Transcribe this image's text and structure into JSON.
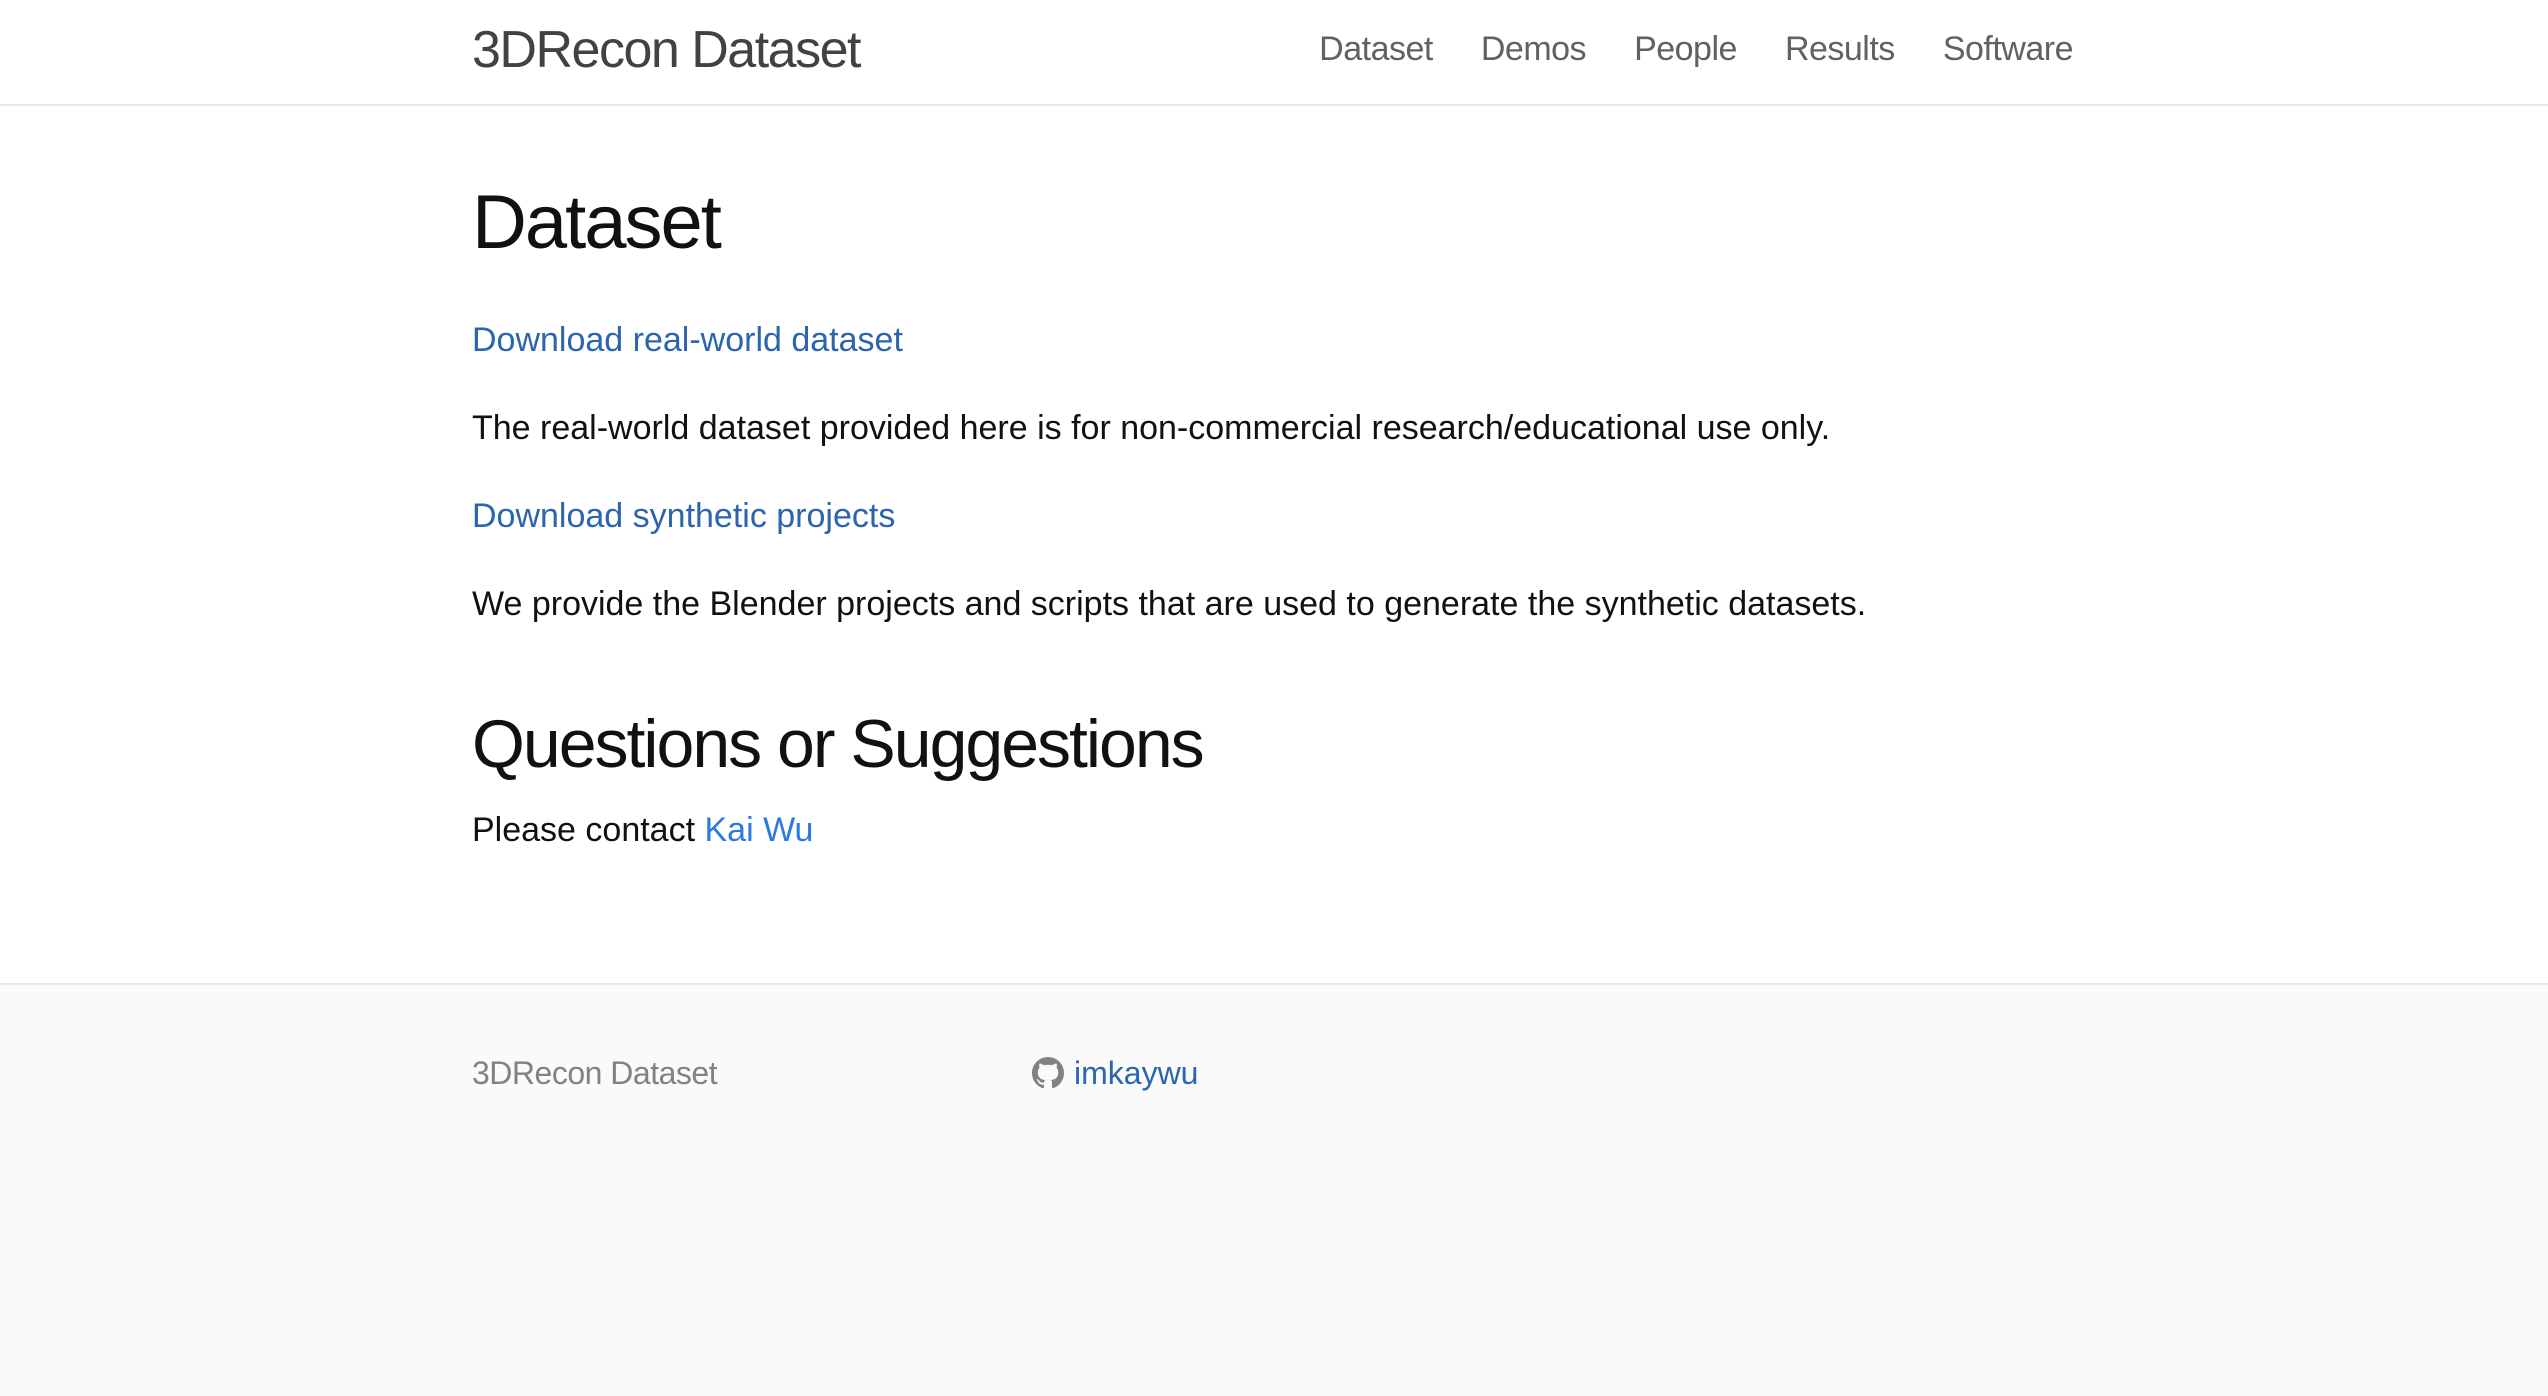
{
  "header": {
    "site_title": "3DRecon Dataset",
    "nav": [
      {
        "label": "Dataset"
      },
      {
        "label": "Demos"
      },
      {
        "label": "People"
      },
      {
        "label": "Results"
      },
      {
        "label": "Software"
      }
    ]
  },
  "main": {
    "heading": "Dataset",
    "realworld_link": "Download real-world dataset",
    "realworld_note": "The real-world dataset provided here is for non-commercial research/educational use only.",
    "synthetic_link": "Download synthetic projects",
    "synthetic_note": "We provide the Blender projects and scripts that are used to generate the synthetic datasets.",
    "questions_heading": "Questions or Suggestions",
    "contact_prefix": "Please contact ",
    "contact_name": "Kai Wu"
  },
  "footer": {
    "site_title": "3DRecon Dataset",
    "github_icon": "github-icon",
    "github_username": "imkaywu"
  },
  "colors": {
    "link": "#2a7ae2",
    "text": "#111111",
    "muted": "#828282",
    "footer_bg": "#fafafa"
  }
}
